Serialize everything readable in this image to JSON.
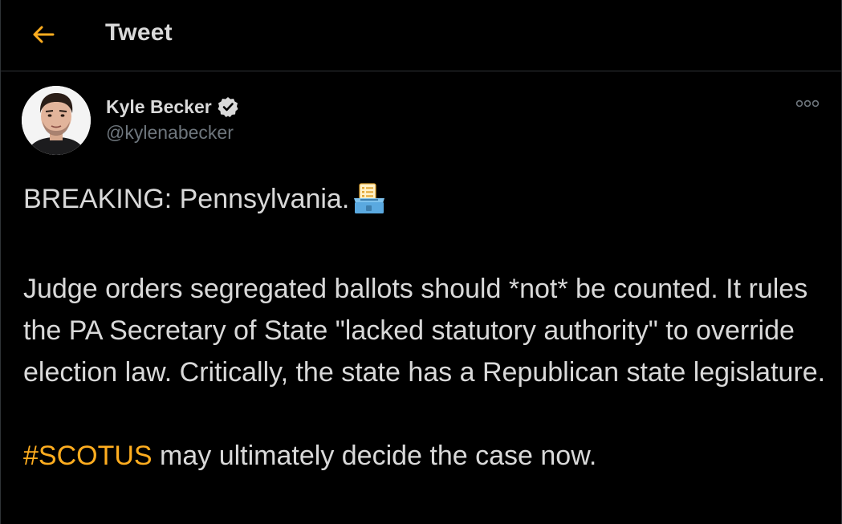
{
  "colors": {
    "background": "#000000",
    "accent": "#ffad1f",
    "text_primary": "#d9d9d9",
    "text_secondary": "#6e767d",
    "divider": "#2f3336"
  },
  "header": {
    "back_icon": "arrow-left-icon",
    "title": "Tweet"
  },
  "author": {
    "name": "Kyle Becker",
    "handle": "@kylenabecker",
    "verified_icon": "verified-badge-icon",
    "more_icon": "more-horizontal-icon"
  },
  "tweet": {
    "line1": "BREAKING: Pennsylvania.",
    "line1_emoji": "ballot-box-icon",
    "paragraph2": "Judge orders segregated ballots should *not* be counted. It rules the PA Secretary of State \"lacked statutory authority\" to override election law. Critically, the state has a Republican state legislature.",
    "hashtag": "#SCOTUS",
    "paragraph3_rest": " may ultimately decide the case now."
  }
}
